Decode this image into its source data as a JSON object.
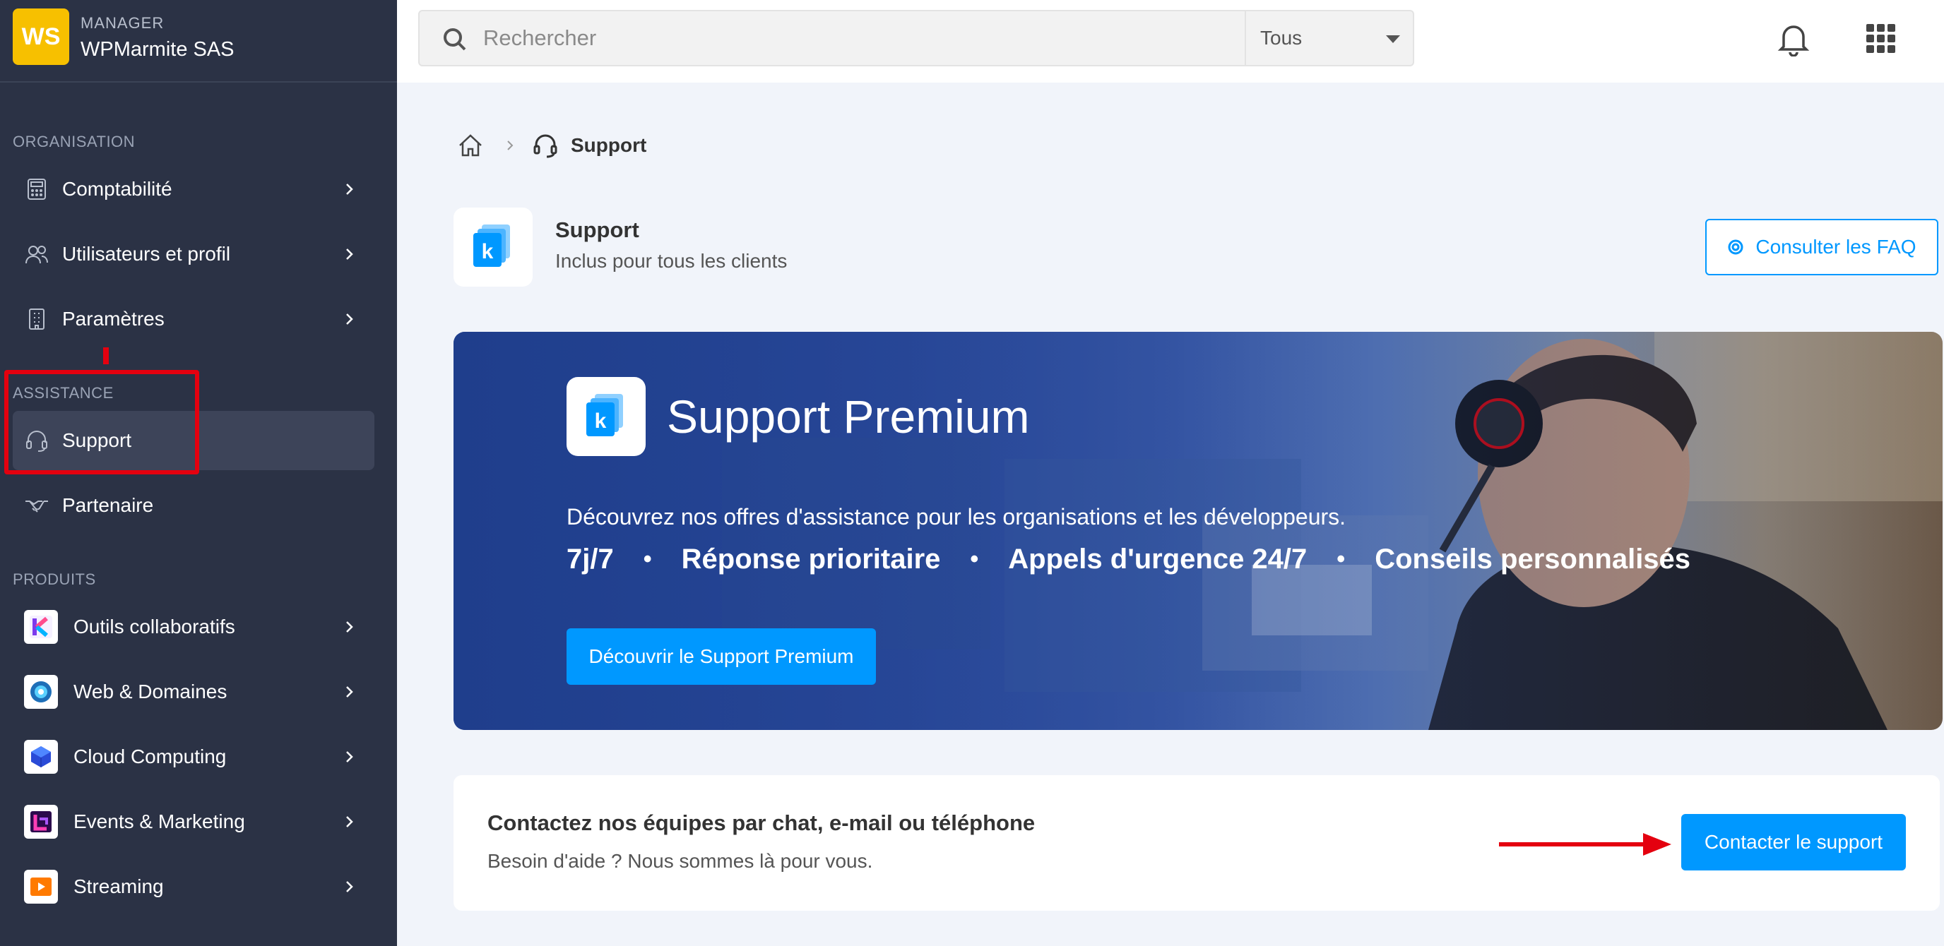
{
  "brand": {
    "initials": "WS",
    "role": "MANAGER",
    "name": "WPMarmite SAS",
    "color": "#f7c000"
  },
  "search": {
    "placeholder": "Rechercher",
    "value": "",
    "filter": "Tous"
  },
  "sidebar": {
    "organisation_title": "ORGANISATION",
    "organisation": [
      {
        "label": "Comptabilité",
        "icon": "calculator-icon"
      },
      {
        "label": "Utilisateurs et profil",
        "icon": "users-icon"
      },
      {
        "label": "Paramètres",
        "icon": "building-icon"
      }
    ],
    "assistance_title": "ASSISTANCE",
    "assistance": [
      {
        "label": "Support",
        "icon": "headset-icon",
        "active": true
      },
      {
        "label": "Partenaire",
        "icon": "handshake-icon"
      }
    ],
    "produits_title": "PRODUITS",
    "produits": [
      {
        "label": "Outils collaboratifs",
        "icon": "kchat-logo-icon"
      },
      {
        "label": "Web & Domaines",
        "icon": "web-domains-icon"
      },
      {
        "label": "Cloud Computing",
        "icon": "cloud-cube-icon"
      },
      {
        "label": "Events & Marketing",
        "icon": "events-icon"
      },
      {
        "label": "Streaming",
        "icon": "play-icon"
      }
    ]
  },
  "breadcrumb": {
    "current": "Support"
  },
  "service": {
    "title": "Support",
    "subtitle": "Inclus pour tous les clients",
    "faq_label": "Consulter les FAQ"
  },
  "banner": {
    "title": "Support Premium",
    "description": "Découvrez nos offres d'assistance pour les organisations et les développeurs.",
    "features": [
      "7j/7",
      "Réponse prioritaire",
      "Appels d'urgence 24/7",
      "Conseils personnalisés"
    ],
    "separator": "•",
    "cta_label": "Découvrir le Support Premium"
  },
  "contact": {
    "title": "Contactez nos équipes par chat, e-mail ou téléphone",
    "subtitle": "Besoin d'aide ? Nous sommes là pour vous.",
    "button_label": "Contacter le support"
  },
  "colors": {
    "accent": "#0098ff",
    "sidebar": "#2b3245",
    "annotation": "#e4000f"
  }
}
